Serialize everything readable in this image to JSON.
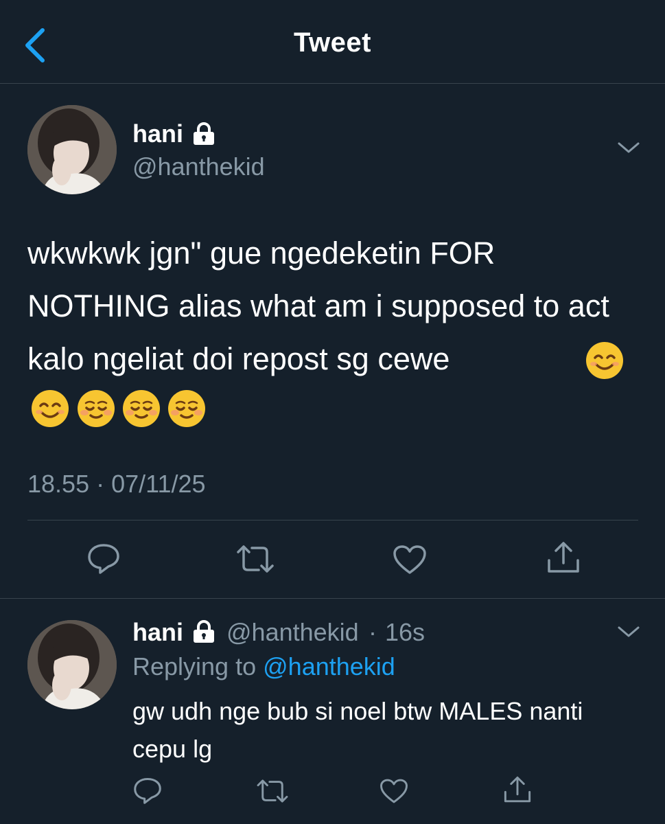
{
  "header": {
    "title": "Tweet",
    "back_icon": "chevron-left-icon",
    "accent": "#1da1f2"
  },
  "tweet": {
    "display_name": "hani",
    "handle": "@hanthekid",
    "protected_icon": "lock-icon",
    "text": "wkwkwk jgn\" gue ngedeketin FOR NOTHING alias what am i supposed to act kalo ngeliat doi repost sg cewe",
    "emojis": [
      "😊",
      "😊",
      "☺️",
      "☺️",
      "☺️"
    ],
    "timestamp": "18.55 · 07/11/25",
    "actions": [
      "reply-icon",
      "retweet-icon",
      "like-icon",
      "share-icon"
    ]
  },
  "reply": {
    "display_name": "hani",
    "handle": "@hanthekid",
    "separator": "·",
    "time": "16s",
    "replying_prefix": "Replying to",
    "replying_to": "@hanthekid",
    "text": "gw udh nge bub si noel btw MALES nanti cepu lg",
    "actions": [
      "reply-icon",
      "retweet-icon",
      "like-icon",
      "share-icon"
    ]
  },
  "colors": {
    "background": "#15202b",
    "secondary_text": "#8899a6",
    "divider": "#38444d",
    "link": "#1da1f2"
  }
}
